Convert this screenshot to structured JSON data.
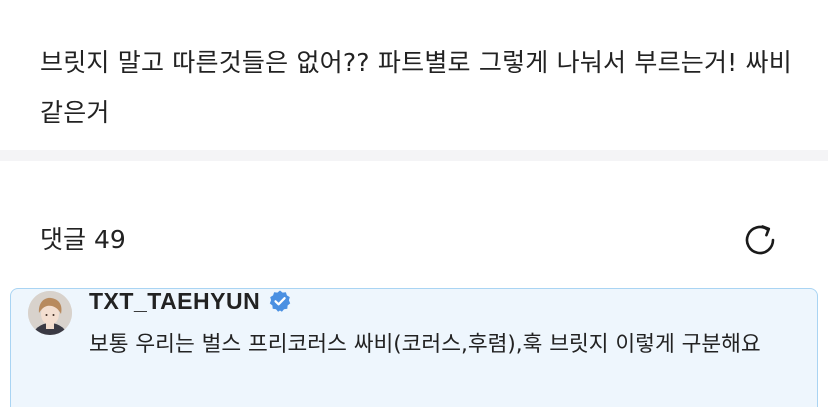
{
  "post": {
    "body": "브릿지 말고 따른것들은 없어?? 파트별로 그렇게 나눠서 부르는거! 싸비같은거"
  },
  "comments": {
    "label": "댓글",
    "count": "49",
    "refresh_icon": "refresh-icon"
  },
  "comment": {
    "author": "TXT_TAEHYUN",
    "verified_icon": "verified-badge-icon",
    "text": "보통 우리는 벌스 프리코러스 싸비(코러스,후렴),훅 브릿지 이렇게 구분해요",
    "accent_color": "#a9d4f3",
    "background_color": "#eef6fd"
  }
}
